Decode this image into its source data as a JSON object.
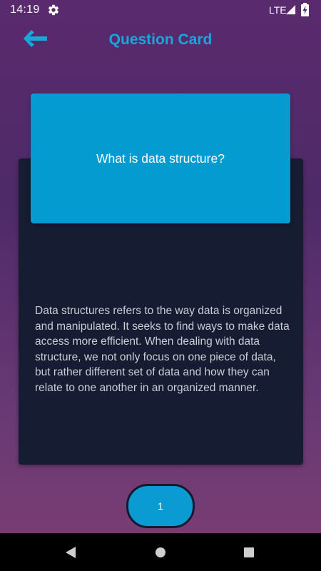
{
  "status_bar": {
    "time": "14:19",
    "network": "LTE",
    "icons": [
      "gear-icon",
      "signal-icon",
      "battery-charging-icon"
    ]
  },
  "app_bar": {
    "title": "Question Card",
    "back_icon": "arrow-left-icon"
  },
  "card": {
    "question": "What is data structure?",
    "answer": "Data structures refers to the way data is organized and manipulated. It seeks to find ways to make data access more efficient. When dealing with data structure, we not only focus on one piece of data, but rather different set of data and how they can relate to one another in an organized manner."
  },
  "counter": {
    "value": "1"
  },
  "nav_bar": {
    "icons": [
      "nav-back-icon",
      "nav-home-icon",
      "nav-recents-icon"
    ]
  },
  "colors": {
    "accent": "#19a6da",
    "card_blue": "#049bd1",
    "panel_dark": "#161d33",
    "background_top": "#5a2a6e",
    "background_bottom": "#7c3d72"
  }
}
